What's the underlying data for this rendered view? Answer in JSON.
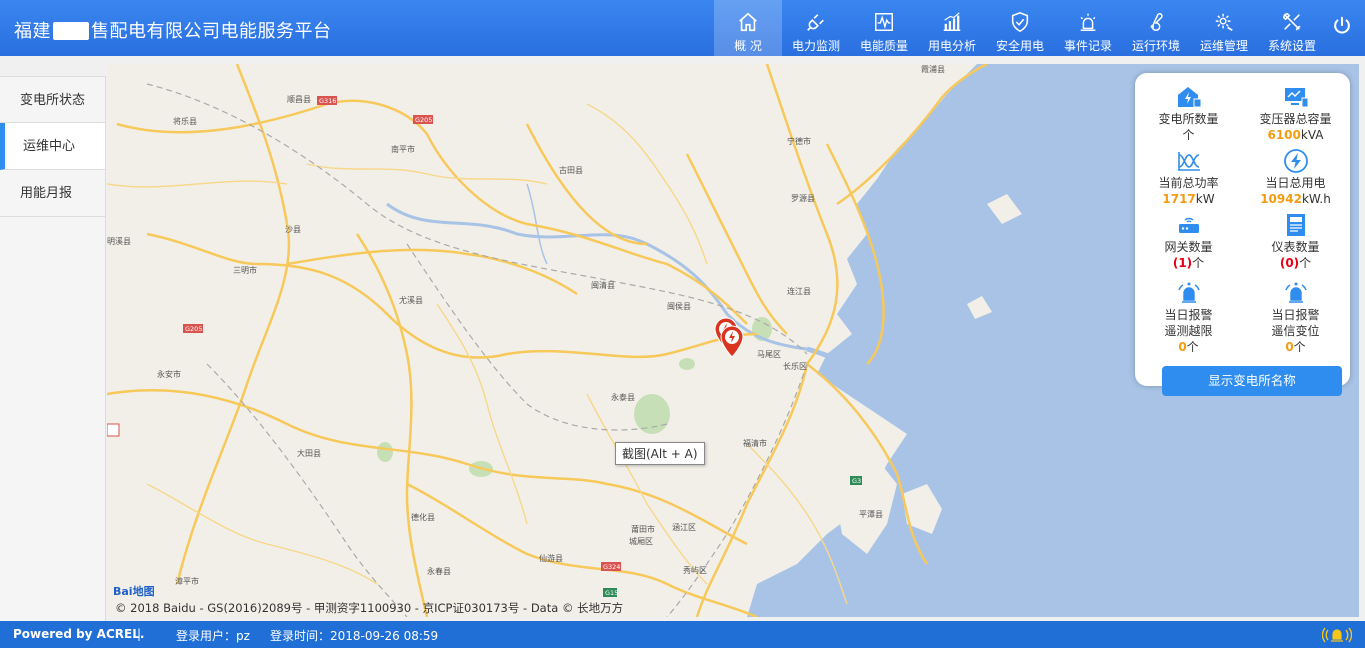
{
  "header": {
    "title_prefix": "福建",
    "title_suffix": "售配电有限公司电能服务平台",
    "nav": [
      {
        "label": "概 况",
        "icon": "home-icon"
      },
      {
        "label": "电力监测",
        "icon": "plug-icon"
      },
      {
        "label": "电能质量",
        "icon": "waveform-icon"
      },
      {
        "label": "用电分析",
        "icon": "bar-chart-icon"
      },
      {
        "label": "安全用电",
        "icon": "shield-check-icon"
      },
      {
        "label": "事件记录",
        "icon": "siren-icon"
      },
      {
        "label": "运行环境",
        "icon": "thermometer-icon"
      },
      {
        "label": "运维管理",
        "icon": "gear-wrench-icon"
      },
      {
        "label": "系统设置",
        "icon": "tools-icon"
      }
    ],
    "active_nav": "概 况"
  },
  "sidebar": {
    "items": [
      {
        "label": "变电所状态"
      },
      {
        "label": "运维中心"
      },
      {
        "label": "用能月报"
      }
    ],
    "active": "运维中心"
  },
  "map": {
    "places": [
      "霞浦县",
      "顺昌县",
      "将乐县",
      "南平市",
      "古田县",
      "宁德市",
      "罗源县",
      "明溪县",
      "沙县",
      "三明市",
      "尤溪县",
      "闽清县",
      "闽侯县",
      "连江县",
      "马尾区",
      "长乐区",
      "永安市",
      "永泰县",
      "大田县",
      "福清市",
      "德化县",
      "莆田市",
      "城厢区",
      "涵江区",
      "仙游县",
      "永春县",
      "秀屿区",
      "平潭县",
      "漳平市"
    ],
    "road_labels": [
      "G316",
      "G205",
      "G205",
      "G3",
      "G324",
      "G15"
    ],
    "copyright": "© 2018 Baidu - GS(2016)2089号 - 甲测资字1100930 - 京ICP证030173号 - Data © 长地万方",
    "logo_text": "Bai",
    "logo_text2": "地图",
    "tooltip": "截图(Alt + A)"
  },
  "stats": {
    "substation_count": {
      "label": "变电所数量",
      "value": "",
      "unit": "个"
    },
    "transformer_capacity": {
      "label": "变压器总容量",
      "value": "6100",
      "unit": "kVA"
    },
    "current_power": {
      "label": "当前总功率",
      "value": "1717",
      "unit": "kW"
    },
    "daily_energy": {
      "label": "当日总用电",
      "value": "10942",
      "unit": "kW.h"
    },
    "gateway_count": {
      "label": "网关数量",
      "value": "(1)",
      "unit": "个"
    },
    "meter_count": {
      "label": "仪表数量",
      "value": "(0)",
      "unit": "个"
    },
    "alarm_limit": {
      "label1": "当日报警",
      "label2": "遥测越限",
      "value": "0",
      "unit": "个"
    },
    "alarm_shift": {
      "label1": "当日报警",
      "label2": "遥信变位",
      "value": "0",
      "unit": "个"
    },
    "show_button": "显示变电所名称"
  },
  "footer": {
    "powered_by": "Powered by ACREL.",
    "separator": "|",
    "user_label": "登录用户：",
    "user": "pz",
    "time_label": "登录时间：",
    "time": "2018-09-26 08:59"
  },
  "colors": {
    "header": "#2a6fe0",
    "accent": "#2e8dee",
    "value_orange": "#f39c12",
    "value_red": "#e60012",
    "sea": "#a8c3e6",
    "land": "#f2efe8",
    "road": "#f7c85a"
  }
}
